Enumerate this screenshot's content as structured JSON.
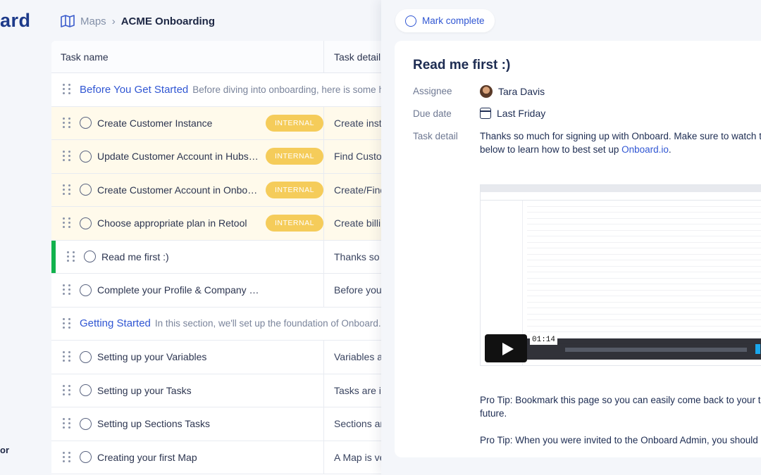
{
  "brand": {
    "logo_text": "ard",
    "sidebar_bottom_text": "or"
  },
  "breadcrumb": {
    "root": "Maps",
    "current": "ACME Onboarding"
  },
  "table": {
    "headers": {
      "name": "Task name",
      "detail": "Task detail"
    },
    "rows": [
      {
        "kind": "section",
        "title": "Before You Get Started",
        "desc": "Before diving into onboarding, here is some helpfu"
      },
      {
        "kind": "task",
        "name": "Create Customer Instance",
        "badge": "INTERNAL",
        "detail": "Create insta"
      },
      {
        "kind": "task",
        "name": "Update Customer Account in Hubspot",
        "badge": "INTERNAL",
        "detail": "Find Custom"
      },
      {
        "kind": "task",
        "name": "Create Customer Account in Onboard I...",
        "badge": "INTERNAL",
        "detail": "Create/Find"
      },
      {
        "kind": "task",
        "name": "Choose appropriate plan in Retool",
        "badge": "INTERNAL",
        "detail": "Create billin"
      },
      {
        "kind": "task",
        "name": "Read me first :)",
        "badge": "",
        "detail": "Thanks so m",
        "active": true
      },
      {
        "kind": "task",
        "name": "Complete your Profile & Company Profile",
        "badge": "",
        "detail": "Before you g"
      },
      {
        "kind": "section",
        "title": "Getting Started",
        "desc": "In this section, we'll set up the foundation of Onboard. Let's"
      },
      {
        "kind": "task",
        "name": "Setting up your Variables",
        "badge": "",
        "detail": "Variables are"
      },
      {
        "kind": "task",
        "name": "Setting up your Tasks",
        "badge": "",
        "detail": "Tasks are in"
      },
      {
        "kind": "task",
        "name": "Setting up Sections Tasks",
        "badge": "",
        "detail": "Sections are"
      },
      {
        "kind": "task",
        "name": "Creating your first Map",
        "badge": "",
        "detail": "A Map is ver"
      }
    ]
  },
  "panel": {
    "mark_complete": "Mark complete",
    "title": "Read me first :)",
    "assignee_label": "Assignee",
    "assignee": "Tara Davis",
    "due_label": "Due date",
    "due": "Last Friday",
    "detail_label": "Task detail",
    "detail_line1": "Thanks so much for signing up with Onboard. Make sure to watch the v",
    "detail_line2_pre": "below to learn how to best set up ",
    "detail_link": "Onboard.io",
    "detail_line2_post": ".",
    "video_time": "01:14",
    "tip1_line1": "Pro Tip: Bookmark this page so you can easily come back to your tasks",
    "tip1_line2": "future.",
    "tip2_line1": "Pro Tip: When you were invited to the Onboard Admin, you should have"
  },
  "colors": {
    "accent": "#3056d3",
    "badge": "#f5cc5a",
    "active_bar": "#12b24d"
  }
}
